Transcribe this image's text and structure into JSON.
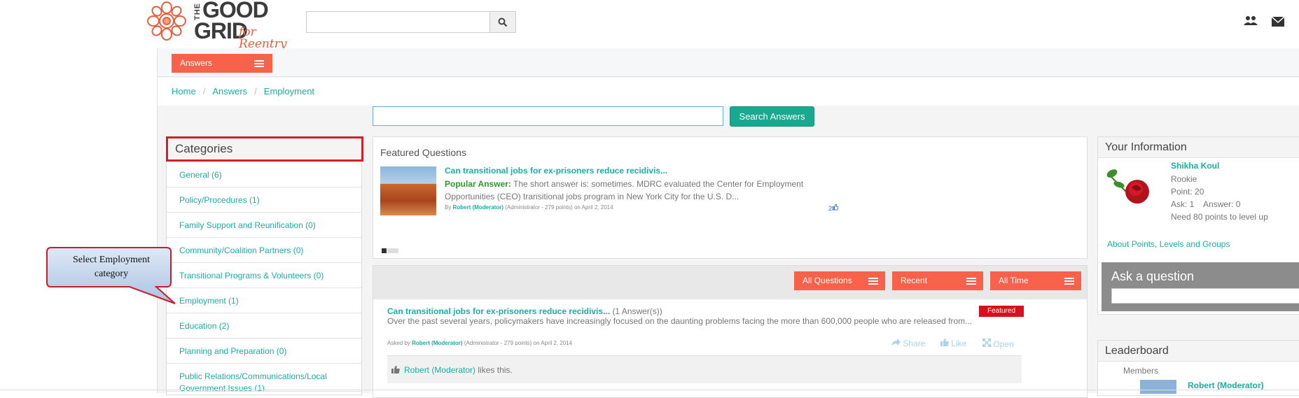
{
  "logo": {
    "the": "THE",
    "good": "GOOD",
    "grid": "GRID",
    "tagline": "for Reentry"
  },
  "top_search": {
    "placeholder": "",
    "value": ""
  },
  "header_icons": [
    "users-icon",
    "mail-icon"
  ],
  "answers_menu": {
    "label": "Answers"
  },
  "breadcrumb": [
    "Home",
    "Answers",
    "Employment"
  ],
  "answer_search": {
    "placeholder": "",
    "value": "",
    "button": "Search Answers"
  },
  "categories": {
    "title": "Categories",
    "items": [
      "General (6)",
      "Policy/Procedures (1)",
      "Family Support and Reunification (0)",
      "Community/Coalition Partners (0)",
      "Transitional Programs & Volunteers (0)",
      "Employment (1)",
      "Education (2)",
      "Planning and Preparation (0)",
      "Public Relations/Communications/Local Government Issues (1)"
    ]
  },
  "featured": {
    "title": "Featured Questions",
    "question": "Can transitional jobs for ex-prisoners reduce recidivis...",
    "popular_answer_label": "Popular Answer:",
    "popular_answer_text": "The short answer is: sometimes. MDRC evaluated the Center for Employment Opportunities (CEO) transitional jobs program in New York City for the U.S. D...",
    "by": "By",
    "author": "Robert (Moderator)",
    "author_meta": "(Administrator - 279 points)  on April 2, 2014",
    "likes": "2"
  },
  "filters": {
    "all_questions": "All Questions",
    "recent": "Recent",
    "all_time": "All Time"
  },
  "question": {
    "title": "Can transitional jobs for ex-prisoners reduce recidivis...",
    "answer_count": "(1 Answer(s))",
    "badge": "Featured",
    "excerpt": "Over the past several years, policymakers have increasingly focused on the daunting problems facing the more than 600,000 people who are released from...",
    "asked_by": "Asked by",
    "author": "Robert (Moderator)",
    "author_meta": "(Administrator - 279 points) on April 2, 2014",
    "share": "Share",
    "like": "Like",
    "open": "Open",
    "liker": "Robert (Moderator)",
    "likes_this": "likes this."
  },
  "your_info": {
    "title": "Your Information",
    "name": "Shikha Koul",
    "rank": "Rookie",
    "points": "Point: 20",
    "ask_answer": "Ask: 1    Answer: 0",
    "level_up": "Need 80 points to level up",
    "about_link_1": "About Points",
    "about_link_sep": ", ",
    "about_link_2": "Levels and Groups",
    "ask_label": "Ask a question"
  },
  "leaderboard": {
    "title": "Leaderboard",
    "members_label": "Members",
    "top_member": "Robert (Moderator)"
  },
  "callout": {
    "text": "Select Employment category"
  },
  "colors": {
    "accent": "#f8624a",
    "link": "#1ab0a0",
    "search_button": "#19a890",
    "badge": "#d9101c",
    "highlight_border": "#d0202c"
  }
}
